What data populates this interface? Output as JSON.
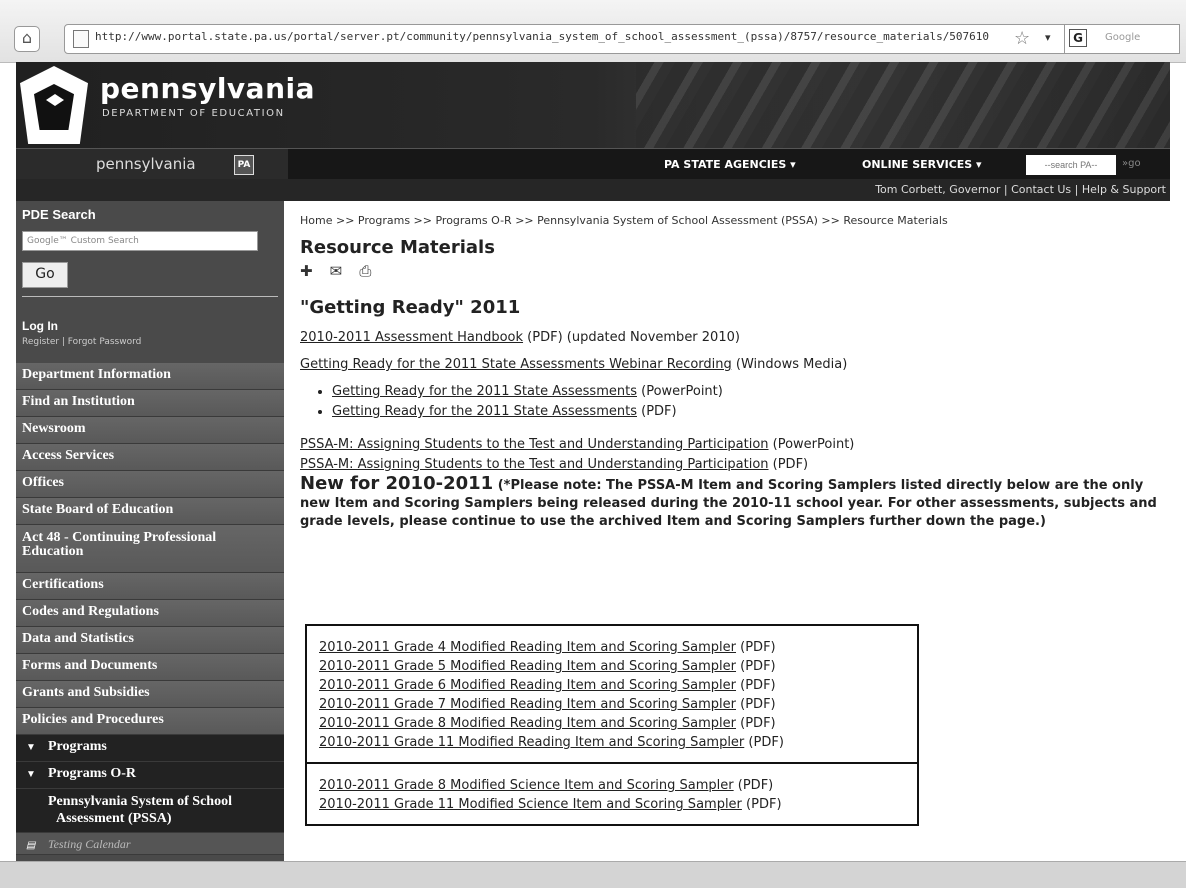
{
  "browser": {
    "url": "http://www.portal.state.pa.us/portal/server.pt/community/pennsylvania_system_of_school_assessment_(pssa)/8757/resource_materials/507610",
    "search_placeholder": "Google"
  },
  "header": {
    "brand": "pennsylvania",
    "dept": "DEPARTMENT OF EDUCATION"
  },
  "nav": {
    "pa_label": "pennsylvania",
    "pa_badge": "PA",
    "agencies": "PA STATE AGENCIES ▾",
    "online": "ONLINE SERVICES ▾",
    "search_placeholder": "--search PA--",
    "go": "»go",
    "utility": "Tom Corbett, Governor | Contact Us | Help & Support"
  },
  "sidebar": {
    "title": "PDE Search",
    "search_placeholder": "Google™ Custom Search",
    "go": "Go",
    "login": "Log In",
    "register": "Register | Forgot Password",
    "items": [
      "Department Information",
      "Find an Institution",
      "Newsroom",
      "Access Services",
      "Offices",
      "State Board of Education",
      "Act 48 - Continuing Professional Education",
      "Certifications",
      "Codes and Regulations",
      "Data and Statistics",
      "Forms and Documents",
      "Grants and Subsidies",
      "Policies and Procedures"
    ],
    "programs": "Programs",
    "programs_or": "Programs O-R",
    "pssa": "Pennsylvania System of School Assessment (PSSA)",
    "testing": "Testing Calendar"
  },
  "content": {
    "breadcrumb": "Home >> Programs >> Programs O-R >> Pennsylvania System of School Assessment (PSSA) >> Resource Materials",
    "title": "Resource Materials",
    "section": "\"Getting Ready\" 2011",
    "handbook_link": "2010-2011 Assessment Handbook",
    "handbook_note": " (PDF) (updated November 2010)",
    "webinar_link": "Getting Ready for the 2011 State Assessments Webinar Recording",
    "webinar_note": " (Windows Media)",
    "bullets": [
      {
        "link": "Getting Ready for the 2011 State Assessments",
        "note": " (PowerPoint)"
      },
      {
        "link": "Getting Ready for the 2011 State Assessments",
        "note": " (PDF)"
      }
    ],
    "pssa_m": [
      {
        "link": "PSSA-M: Assigning Students to the Test and Understanding Participation",
        "note": " (PowerPoint)"
      },
      {
        "link": "PSSA-M: Assigning Students to the Test and Understanding Participation",
        "note": " (PDF)"
      }
    ],
    "new_title": "New for 2010-2011",
    "new_note": " (*Please note:  The PSSA-M Item and Scoring Samplers listed directly below are the only new Item and Scoring Samplers being released during the 2010-11 school year.  For other assessments, subjects and grade levels, please continue to use the archived Item and Scoring Samplers further down the page.)",
    "reading": [
      "2010-2011 Grade 4 Modified Reading Item and Scoring Sampler",
      "2010-2011 Grade 5 Modified Reading Item and Scoring Sampler",
      "2010-2011 Grade 6 Modified Reading Item and Scoring Sampler",
      "2010-2011 Grade 7 Modified Reading Item and Scoring Sampler",
      "2010-2011 Grade 8 Modified Reading Item and Scoring Sampler",
      "2010-2011 Grade 11 Modified Reading Item and Scoring Sampler"
    ],
    "science": [
      "2010-2011 Grade 8 Modified Science Item and Scoring Sampler",
      "2010-2011 Grade 11 Modified Science Item and Scoring Sampler"
    ],
    "pdf": " (PDF)"
  }
}
